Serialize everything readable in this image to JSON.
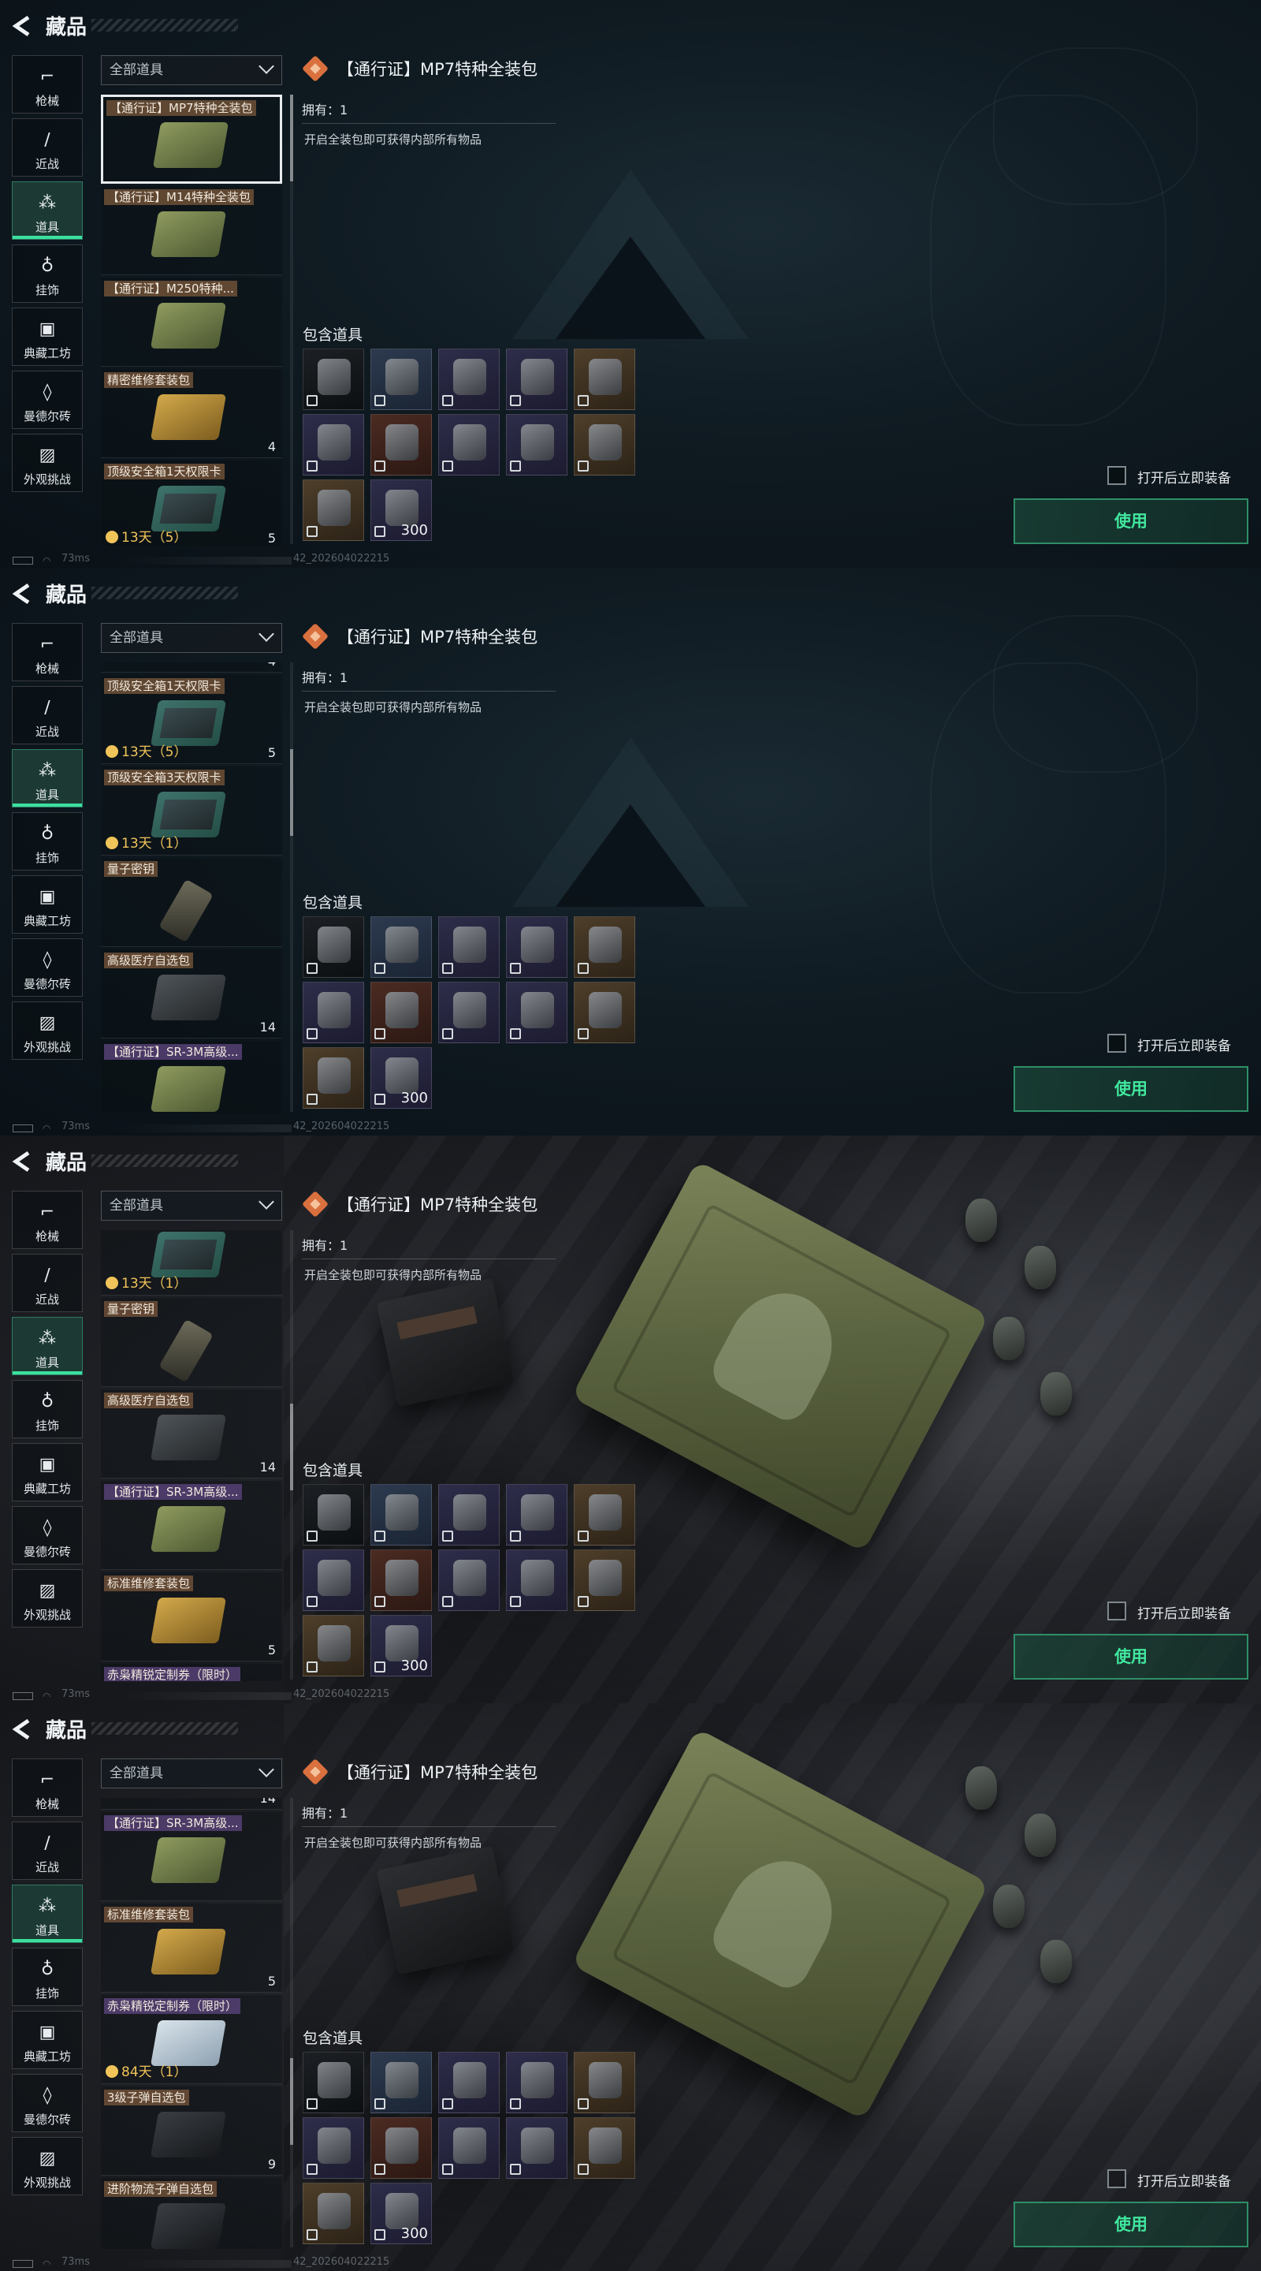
{
  "app": {
    "title": "藏品",
    "back_icon": "back-arrow-icon"
  },
  "sidebar": [
    {
      "label": "枪械",
      "icon": "gun-icon",
      "glyph": "⌐"
    },
    {
      "label": "近战",
      "icon": "knife-icon",
      "glyph": "∕"
    },
    {
      "label": "道具",
      "icon": "items-icon",
      "glyph": "⁂",
      "active": true
    },
    {
      "label": "挂饰",
      "icon": "charm-icon",
      "glyph": "♁"
    },
    {
      "label": "典藏工坊",
      "icon": "workshop-icon",
      "glyph": "▣"
    },
    {
      "label": "曼德尔砖",
      "icon": "mandel-brick-icon",
      "glyph": "◊"
    },
    {
      "label": "外观挑战",
      "icon": "appearance-challenge-icon",
      "glyph": "▨"
    }
  ],
  "filter": {
    "value": "全部道具",
    "icon": "chevron-down-icon"
  },
  "items": [
    {
      "name": "【通行证】MP7特种全装包",
      "img": "green",
      "count": "",
      "timer": ""
    },
    {
      "name": "【通行证】M14特种全装包",
      "img": "green",
      "count": "",
      "timer": ""
    },
    {
      "name": "【通行证】M250特种...",
      "img": "green",
      "count": "",
      "timer": ""
    },
    {
      "name": "精密维修套装包",
      "img": "gold",
      "count": "4",
      "timer": ""
    },
    {
      "name": "顶级安全箱1天权限卡",
      "img": "teal",
      "count": "5",
      "timer": "13天（5）"
    },
    {
      "name": "顶级安全箱3天权限卡",
      "img": "teal",
      "count": "",
      "timer": "13天（1）"
    },
    {
      "name": "量子密钥",
      "img": "key",
      "count": "",
      "timer": ""
    },
    {
      "name": "高级医疗自选包",
      "img": "med",
      "count": "14",
      "timer": ""
    },
    {
      "name": "【通行证】SR-3M高级...",
      "img": "green",
      "count": "",
      "timer": "",
      "purple": true
    },
    {
      "name": "标准维修套装包",
      "img": "gold",
      "count": "5",
      "timer": ""
    },
    {
      "name": "赤枭精锐定制券（限时）",
      "img": "pale",
      "count": "",
      "timer": "84天（1）",
      "purple": true
    },
    {
      "name": "3级子弹自选包",
      "img": "dark",
      "count": "9",
      "timer": ""
    },
    {
      "name": "进阶物流子弹自选包",
      "img": "dark",
      "count": "",
      "timer": ""
    }
  ],
  "detail": {
    "rarity_icon": "orange-rarity-icon",
    "title": "【通行证】MP7特种全装包",
    "owned": "拥有：1",
    "description": "开启全装包即可获得内部所有物品",
    "contains_label": "包含道具",
    "contents": [
      {
        "icon": "sling-icon",
        "quality": "black",
        "count": ""
      },
      {
        "icon": "backpack-icon",
        "quality": "blue",
        "count": ""
      },
      {
        "icon": "chest-rig-icon",
        "quality": "purple",
        "count": ""
      },
      {
        "icon": "helmet-icon",
        "quality": "purple",
        "count": ""
      },
      {
        "icon": "body-armor-icon",
        "quality": "gold",
        "count": ""
      },
      {
        "icon": "headset-icon",
        "quality": "purple",
        "count": ""
      },
      {
        "icon": "medkit-icon",
        "quality": "red",
        "count": ""
      },
      {
        "icon": "syringe-icon",
        "quality": "purple",
        "count": ""
      },
      {
        "icon": "gadget-icon",
        "quality": "purple",
        "count": ""
      },
      {
        "icon": "case-icon",
        "quality": "gold",
        "count": ""
      },
      {
        "icon": "battery-pack-icon",
        "quality": "gold",
        "count": ""
      },
      {
        "icon": "ammo-box-icon",
        "quality": "purple",
        "count": "300"
      }
    ],
    "auto_equip_label": "打开后立即装备",
    "use_label": "使用"
  },
  "status": {
    "ping": "73ms",
    "build": "42_20260402​2215"
  },
  "colors": {
    "accent": "#41e89f",
    "rarity_orange": "#d9703e",
    "active_tab": "#1c3a33"
  }
}
